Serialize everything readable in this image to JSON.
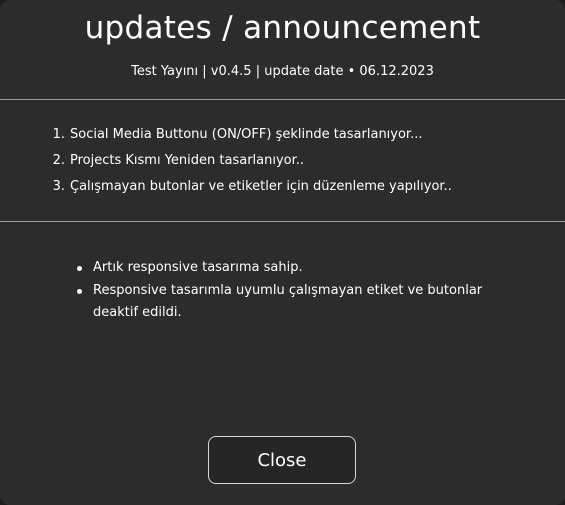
{
  "dialog": {
    "title": "updates / announcement",
    "subtitle": "Test Yayını | v0.4.5 | update date • 06.12.2023",
    "updates": [
      {
        "number": "1.",
        "text": "Social Media Buttonu (ON/OFF) şeklinde tasarlanıyor..."
      },
      {
        "number": "2.",
        "text": "Projects Kısmı Yeniden tasarlanıyor.."
      },
      {
        "number": "3.",
        "text": "Çalışmayan butonlar ve etiketler için düzenleme yapılıyor.."
      }
    ],
    "features": [
      {
        "text": "Artık responsive tasarıma sahip."
      },
      {
        "text": "Responsive tasarımla uyumlu çalışmayan etiket ve butonlar deaktif edildi."
      }
    ],
    "close_label": "Close"
  },
  "colors": {
    "background": "#2c2c2c",
    "text": "#ffffff",
    "divider": "#9a9a9a",
    "button_border": "#d8d8d8"
  }
}
